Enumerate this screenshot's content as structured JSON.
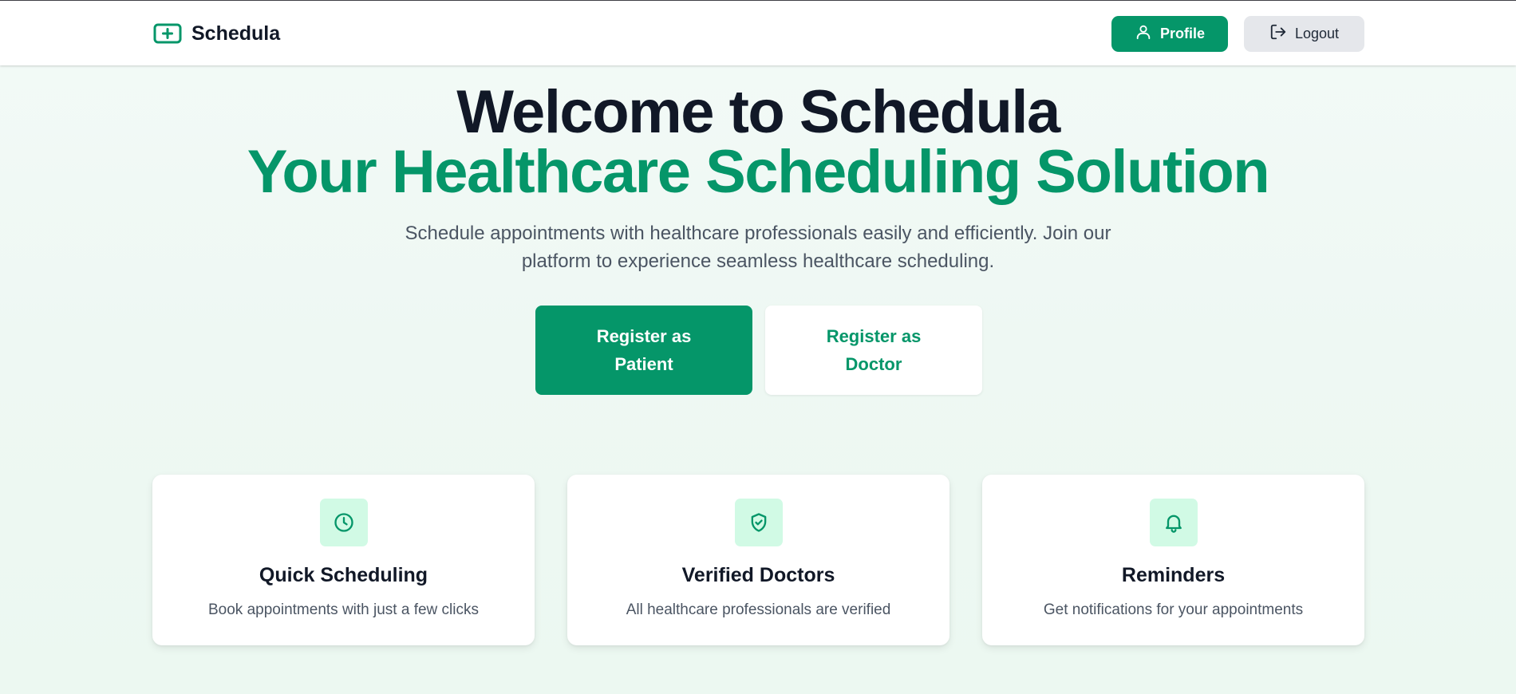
{
  "colors": {
    "accent": "#059669",
    "accent_light": "#d1fae5",
    "text_dark": "#111827",
    "text_muted": "#4b5563",
    "logout_bg": "#e5e7eb"
  },
  "header": {
    "brand": {
      "icon": "medical-plus-icon",
      "name": "Schedula"
    },
    "profile_button": {
      "icon": "user-icon",
      "label": "Profile"
    },
    "logout_button": {
      "icon": "logout-icon",
      "label": "Logout"
    }
  },
  "hero": {
    "title_line1": "Welcome to Schedula",
    "title_line2": "Your Healthcare Scheduling Solution",
    "subtitle": "Schedule appointments with healthcare professionals easily and efficiently. Join our platform to experience seamless healthcare scheduling.",
    "cta_patient": "Register as Patient",
    "cta_doctor": "Register as Doctor"
  },
  "features": [
    {
      "icon": "clock-icon",
      "title": "Quick Scheduling",
      "description": "Book appointments with just a few clicks"
    },
    {
      "icon": "shield-check-icon",
      "title": "Verified Doctors",
      "description": "All healthcare professionals are verified"
    },
    {
      "icon": "bell-icon",
      "title": "Reminders",
      "description": "Get notifications for your appointments"
    }
  ]
}
